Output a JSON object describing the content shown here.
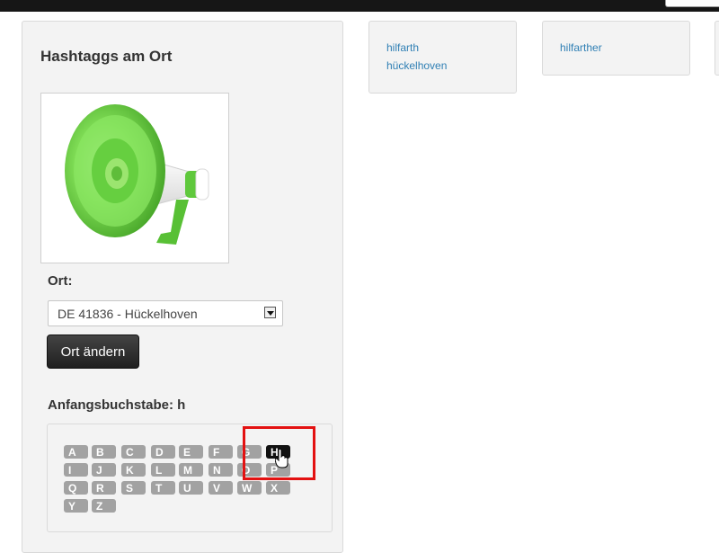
{
  "panel": {
    "title": "Hashtaggs am Ort",
    "image_subject": "megaphone-icon",
    "ort_label": "Ort:",
    "ort_select_value": "DE 41836 - Hückelhoven",
    "change_button": "Ort ändern",
    "letter_heading": "Anfangsbuchstabe: h",
    "selected_letter": "H",
    "letters": [
      "A",
      "B",
      "C",
      "D",
      "E",
      "F",
      "G",
      "H",
      "I",
      "J",
      "K",
      "L",
      "M",
      "N",
      "O",
      "P",
      "Q",
      "R",
      "S",
      "T",
      "U",
      "V",
      "W",
      "X",
      "Y",
      "Z"
    ]
  },
  "tag_cards": [
    {
      "links": [
        "hilfarth",
        "hückelhoven"
      ]
    },
    {
      "links": [
        "hilfarther"
      ]
    }
  ],
  "colors": {
    "topbar": "#161616",
    "panel_bg": "#f3f3f3",
    "key_bg": "#a2a2a2",
    "key_active": "#111111",
    "link": "#2f7fb4",
    "highlight": "#e31111",
    "megaphone_green": "#6fd44e"
  }
}
